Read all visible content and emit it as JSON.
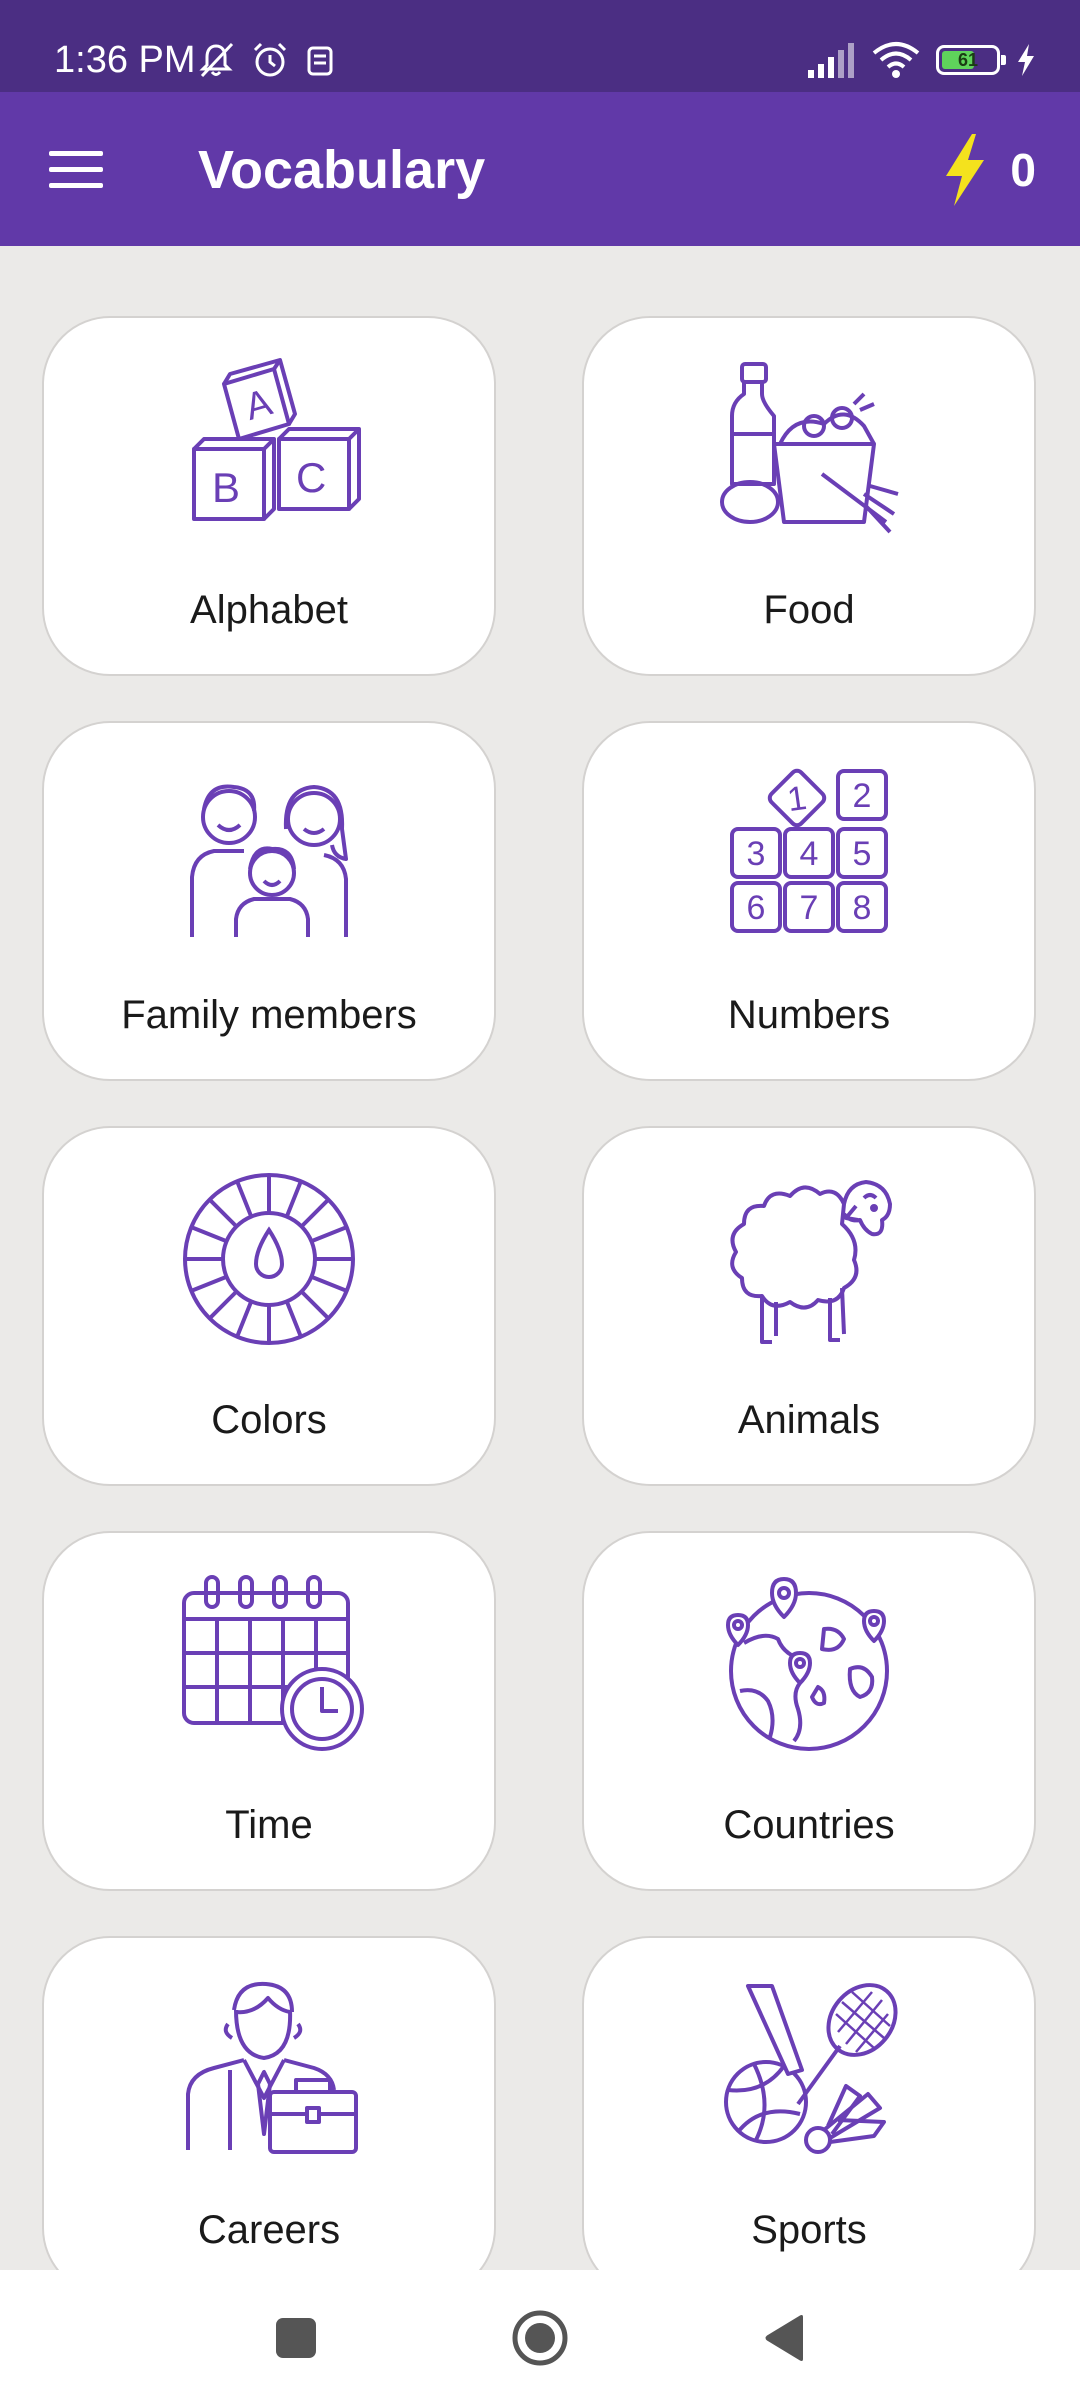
{
  "status_bar": {
    "time": "1:36 PM",
    "left_icons": [
      "mute-icon",
      "alarm-icon",
      "notification-app-icon"
    ],
    "right_icons": [
      "signal-icon",
      "wifi-icon",
      "battery-icon",
      "charging-icon"
    ],
    "battery_percent": "61",
    "battery_level": 0.61
  },
  "app_bar": {
    "title": "Vocabulary",
    "menu_icon": "hamburger-menu-icon",
    "energy_icon": "lightning-bolt-icon",
    "energy_count": "0"
  },
  "colors": {
    "status_bar": "#4b2e83",
    "app_bar": "#6139a8",
    "icon_purple": "#6a3fb5",
    "bolt_yellow": "#f4e21d",
    "background": "#ebeae8"
  },
  "categories": [
    {
      "label": "Alphabet",
      "icon": "alphabet-blocks-icon"
    },
    {
      "label": "Food",
      "icon": "grocery-bag-icon"
    },
    {
      "label": "Family members",
      "icon": "family-icon"
    },
    {
      "label": "Numbers",
      "icon": "number-blocks-icon"
    },
    {
      "label": "Colors",
      "icon": "color-wheel-icon"
    },
    {
      "label": "Animals",
      "icon": "sheep-icon"
    },
    {
      "label": "Time",
      "icon": "calendar-clock-icon"
    },
    {
      "label": "Countries",
      "icon": "globe-pins-icon"
    },
    {
      "label": "Careers",
      "icon": "businessman-icon"
    },
    {
      "label": "Sports",
      "icon": "sports-equipment-icon"
    }
  ],
  "nav_bar": {
    "buttons": [
      "recents-square-icon",
      "home-circle-icon",
      "back-triangle-icon"
    ]
  }
}
